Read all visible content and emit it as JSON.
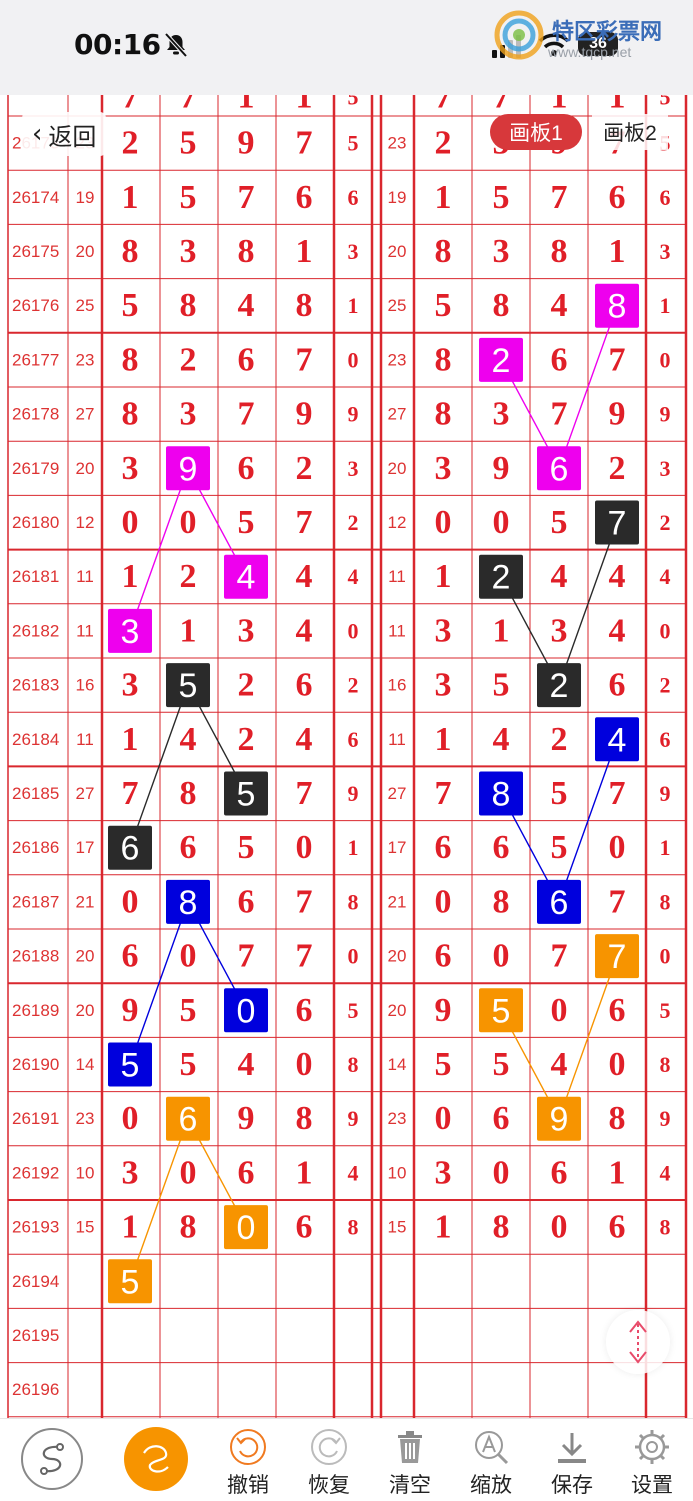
{
  "status_bar": {
    "time": "00:16",
    "silent_icon": "bell-slash-icon",
    "signal_icon": "signal-icon",
    "wifi_icon": "wifi-icon",
    "battery": "36"
  },
  "watermark": {
    "title": "特区彩票网",
    "url": "www.tqcp.net"
  },
  "nav": {
    "back_label": "返回",
    "tabs": [
      "画板1",
      "画板2"
    ],
    "active_tab": 0
  },
  "partial_top_row": {
    "left": [
      "7",
      "7",
      "1",
      "1",
      "5"
    ],
    "right": [
      "7",
      "7",
      "1",
      "1",
      "5"
    ]
  },
  "rows": [
    {
      "issue": "26173",
      "sum": "23",
      "digits": [
        "2",
        "5",
        "9",
        "7"
      ],
      "span": "5"
    },
    {
      "issue": "26174",
      "sum": "19",
      "digits": [
        "1",
        "5",
        "7",
        "6"
      ],
      "span": "6"
    },
    {
      "issue": "26175",
      "sum": "20",
      "digits": [
        "8",
        "3",
        "8",
        "1"
      ],
      "span": "3"
    },
    {
      "issue": "26176",
      "sum": "25",
      "digits": [
        "5",
        "8",
        "4",
        "8"
      ],
      "span": "1"
    },
    {
      "issue": "26177",
      "sum": "23",
      "digits": [
        "8",
        "2",
        "6",
        "7"
      ],
      "span": "0"
    },
    {
      "issue": "26178",
      "sum": "27",
      "digits": [
        "8",
        "3",
        "7",
        "9"
      ],
      "span": "9"
    },
    {
      "issue": "26179",
      "sum": "20",
      "digits": [
        "3",
        "9",
        "6",
        "2"
      ],
      "span": "3"
    },
    {
      "issue": "26180",
      "sum": "12",
      "digits": [
        "0",
        "0",
        "5",
        "7"
      ],
      "span": "2"
    },
    {
      "issue": "26181",
      "sum": "11",
      "digits": [
        "1",
        "2",
        "4",
        "4"
      ],
      "span": "4"
    },
    {
      "issue": "26182",
      "sum": "11",
      "digits": [
        "3",
        "1",
        "3",
        "4"
      ],
      "span": "0"
    },
    {
      "issue": "26183",
      "sum": "16",
      "digits": [
        "3",
        "5",
        "2",
        "6"
      ],
      "span": "2"
    },
    {
      "issue": "26184",
      "sum": "11",
      "digits": [
        "1",
        "4",
        "2",
        "4"
      ],
      "span": "6"
    },
    {
      "issue": "26185",
      "sum": "27",
      "digits": [
        "7",
        "8",
        "5",
        "7"
      ],
      "span": "9"
    },
    {
      "issue": "26186",
      "sum": "17",
      "digits": [
        "6",
        "6",
        "5",
        "0"
      ],
      "span": "1"
    },
    {
      "issue": "26187",
      "sum": "21",
      "digits": [
        "0",
        "8",
        "6",
        "7"
      ],
      "span": "8"
    },
    {
      "issue": "26188",
      "sum": "20",
      "digits": [
        "6",
        "0",
        "7",
        "7"
      ],
      "span": "0"
    },
    {
      "issue": "26189",
      "sum": "20",
      "digits": [
        "9",
        "5",
        "0",
        "6"
      ],
      "span": "5"
    },
    {
      "issue": "26190",
      "sum": "14",
      "digits": [
        "5",
        "5",
        "4",
        "0"
      ],
      "span": "8"
    },
    {
      "issue": "26191",
      "sum": "23",
      "digits": [
        "0",
        "6",
        "9",
        "8"
      ],
      "span": "9"
    },
    {
      "issue": "26192",
      "sum": "10",
      "digits": [
        "3",
        "0",
        "6",
        "1"
      ],
      "span": "4"
    },
    {
      "issue": "26193",
      "sum": "15",
      "digits": [
        "1",
        "8",
        "0",
        "6"
      ],
      "span": "8"
    },
    {
      "issue": "26194",
      "sum": "",
      "digits": [
        "",
        "",
        "",
        ""
      ],
      "span": ""
    },
    {
      "issue": "26195",
      "sum": "",
      "digits": [
        "",
        "",
        "",
        ""
      ],
      "span": ""
    },
    {
      "issue": "26196",
      "sum": "",
      "digits": [
        "",
        "",
        "",
        ""
      ],
      "span": ""
    }
  ],
  "colors": {
    "magenta": "#ee00ee",
    "black": "#2a2a2a",
    "blue": "#0000dd",
    "orange": "#f79400",
    "grid_red": "#d9272e",
    "digit_red": "#e01f28"
  },
  "left_highlights": [
    {
      "row": 6,
      "col": 1,
      "value": "9",
      "color": "magenta"
    },
    {
      "row": 8,
      "col": 2,
      "value": "4",
      "color": "magenta"
    },
    {
      "row": 9,
      "col": 0,
      "value": "3",
      "color": "magenta"
    },
    {
      "row": 10,
      "col": 1,
      "value": "5",
      "color": "black"
    },
    {
      "row": 12,
      "col": 2,
      "value": "5",
      "color": "black"
    },
    {
      "row": 13,
      "col": 0,
      "value": "6",
      "color": "black"
    },
    {
      "row": 14,
      "col": 1,
      "value": "8",
      "color": "blue"
    },
    {
      "row": 16,
      "col": 2,
      "value": "0",
      "color": "blue"
    },
    {
      "row": 17,
      "col": 0,
      "value": "5",
      "color": "blue"
    },
    {
      "row": 18,
      "col": 1,
      "value": "6",
      "color": "orange"
    },
    {
      "row": 20,
      "col": 2,
      "value": "0",
      "color": "orange"
    },
    {
      "row": 21,
      "col": 0,
      "value": "5",
      "color": "orange"
    }
  ],
  "right_highlights": [
    {
      "row": 3,
      "col": 3,
      "value": "8",
      "color": "magenta"
    },
    {
      "row": 4,
      "col": 1,
      "value": "2",
      "color": "magenta"
    },
    {
      "row": 6,
      "col": 2,
      "value": "6",
      "color": "magenta"
    },
    {
      "row": 7,
      "col": 3,
      "value": "7",
      "color": "black"
    },
    {
      "row": 8,
      "col": 1,
      "value": "2",
      "color": "black"
    },
    {
      "row": 10,
      "col": 2,
      "value": "2",
      "color": "black"
    },
    {
      "row": 11,
      "col": 3,
      "value": "4",
      "color": "blue"
    },
    {
      "row": 12,
      "col": 1,
      "value": "8",
      "color": "blue"
    },
    {
      "row": 14,
      "col": 2,
      "value": "6",
      "color": "blue"
    },
    {
      "row": 15,
      "col": 3,
      "value": "7",
      "color": "orange"
    },
    {
      "row": 16,
      "col": 1,
      "value": "5",
      "color": "orange"
    },
    {
      "row": 18,
      "col": 2,
      "value": "9",
      "color": "orange"
    }
  ],
  "left_lines": [
    {
      "from": 0,
      "to": 1,
      "color": "magenta"
    },
    {
      "from": 0,
      "to": 2,
      "color": "magenta"
    },
    {
      "from": 3,
      "to": 4,
      "color": "black"
    },
    {
      "from": 3,
      "to": 5,
      "color": "black"
    },
    {
      "from": 6,
      "to": 7,
      "color": "blue"
    },
    {
      "from": 6,
      "to": 8,
      "color": "blue"
    },
    {
      "from": 9,
      "to": 10,
      "color": "orange"
    },
    {
      "from": 9,
      "to": 11,
      "color": "orange"
    }
  ],
  "right_lines": [
    {
      "from": 0,
      "to": 2,
      "color": "magenta"
    },
    {
      "from": 1,
      "to": 2,
      "color": "magenta"
    },
    {
      "from": 3,
      "to": 5,
      "color": "black"
    },
    {
      "from": 4,
      "to": 5,
      "color": "black"
    },
    {
      "from": 6,
      "to": 8,
      "color": "blue"
    },
    {
      "from": 7,
      "to": 8,
      "color": "blue"
    },
    {
      "from": 9,
      "to": 11,
      "color": "orange"
    },
    {
      "from": 10,
      "to": 11,
      "color": "orange"
    }
  ],
  "toolbar": [
    {
      "label": "",
      "icon": "curve-s-icon"
    },
    {
      "label": "",
      "icon": "freehand-draw-icon"
    },
    {
      "label": "撤销",
      "icon": "undo-icon"
    },
    {
      "label": "恢复",
      "icon": "redo-icon"
    },
    {
      "label": "清空",
      "icon": "trash-icon"
    },
    {
      "label": "缩放",
      "icon": "zoom-icon"
    },
    {
      "label": "保存",
      "icon": "download-icon"
    },
    {
      "label": "设置",
      "icon": "gear-icon"
    }
  ]
}
